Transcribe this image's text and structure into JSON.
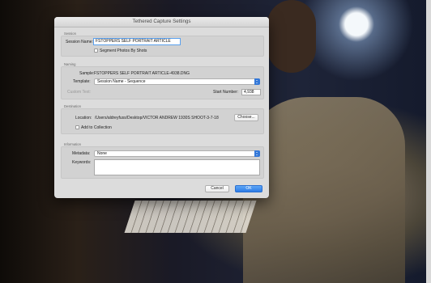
{
  "dialog": {
    "title": "Tethered Capture Settings"
  },
  "session": {
    "section_label": "Session",
    "name_label": "Session Name:",
    "name_value": "FSTOPPERS SELF PORTRAIT ARTICLE",
    "segment_label": "Segment Photos By Shots",
    "segment_checked": false
  },
  "naming": {
    "section_label": "Naming",
    "sample_label": "Sample:",
    "sample_value": "FSTOPPERS SELF PORTRAIT ARTICLE-4938.DNG",
    "template_label": "Template:",
    "template_value": "Session Name - Sequence",
    "custom_text_label": "Custom Text:",
    "start_number_label": "Start Number:",
    "start_number_value": "4,938"
  },
  "destination": {
    "section_label": "Destination",
    "location_label": "Location:",
    "location_value": "/Users/aldreyfuss/Desktop/VICTOR ANDREW 1930S SHOOT-3-7-18",
    "choose_label": "Choose...",
    "add_collection_label": "Add to Collection",
    "add_collection_checked": false
  },
  "information": {
    "section_label": "Information",
    "metadata_label": "Metadata:",
    "metadata_value": "None",
    "keywords_label": "Keywords:",
    "keywords_value": ""
  },
  "buttons": {
    "cancel": "Cancel",
    "ok": "OK"
  },
  "colors": {
    "accent": "#2c7be5",
    "dialog_bg": "#dcdcdc",
    "focus_ring": "#5aa0ee"
  }
}
